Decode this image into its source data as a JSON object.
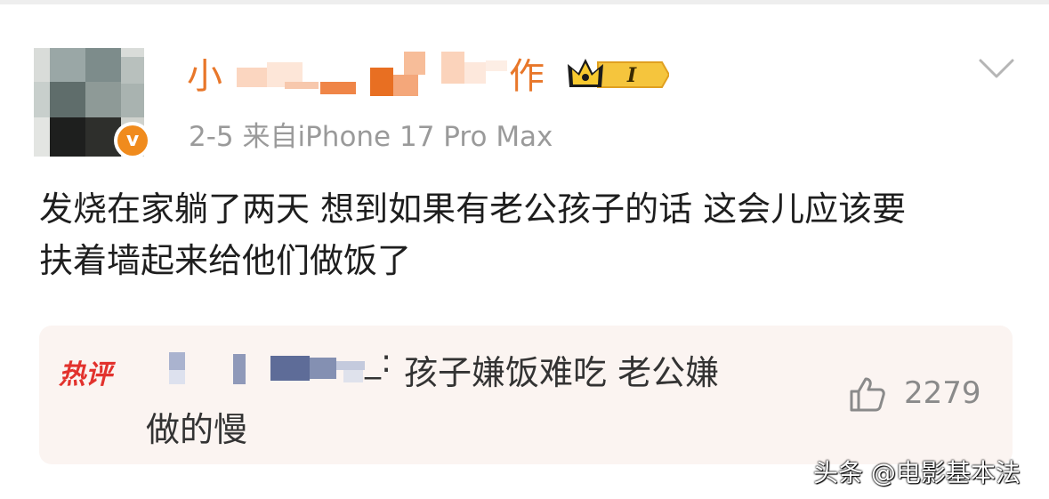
{
  "post": {
    "username_first_char": "小",
    "username_last_char": "作",
    "vip_level_label": "I",
    "meta_text": "2-5  来自iPhone 17 Pro Max",
    "verified_mark": "v",
    "body_lines": [
      "发烧在家躺了两天 想到如果有老公孩子的话 这会儿应该要",
      "扶着墙起来给他们做饭了"
    ]
  },
  "hot_comment": {
    "tag": "热评",
    "username_suffix": "_:",
    "text_line1": "孩子嫌饭难吃 老公嫌",
    "text_line2": "做的慢",
    "like_count": "2279"
  },
  "watermark": "头条 @电影基本法",
  "colors": {
    "accent_orange": "#e8772a",
    "verified_orange": "#f08b1d",
    "hot_red": "#e2322d",
    "hot_box_bg": "#fbf4f1",
    "meta_gray": "#9a9a9a"
  },
  "icons": [
    "verified-badge-icon",
    "crown-vip-icon",
    "chevron-down-icon",
    "thumbs-up-icon"
  ]
}
